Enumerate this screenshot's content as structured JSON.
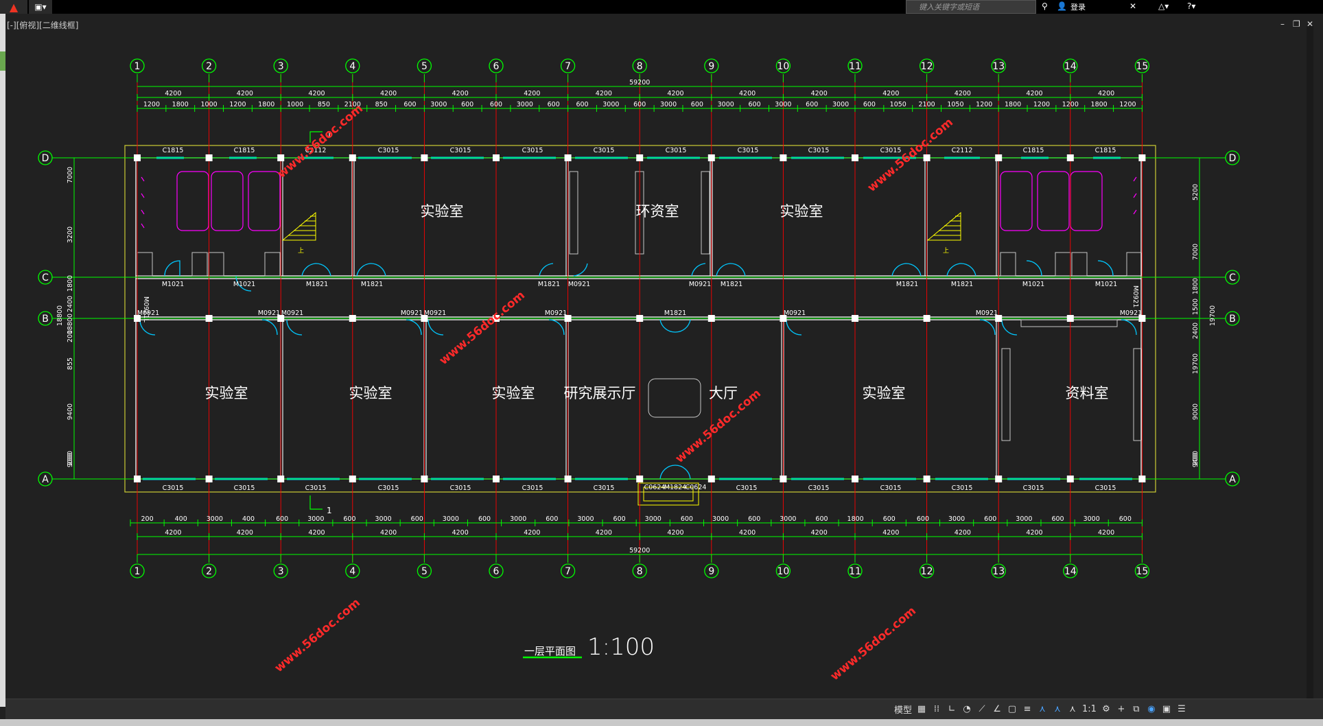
{
  "app": {
    "search_placeholder": "键入关键字或短语",
    "login_label": "登录",
    "view_label": "[-][俯视][二维线框]"
  },
  "drawing": {
    "axes_numbers": [
      "1",
      "2",
      "3",
      "4",
      "5",
      "6",
      "7",
      "8",
      "9",
      "10",
      "11",
      "12",
      "13",
      "14",
      "15"
    ],
    "axes_letters": [
      "D",
      "C",
      "B",
      "A"
    ],
    "total_dimension": "59200",
    "right_total": "19700",
    "left_total": "18800",
    "top_bay_dims": [
      "4200",
      "4200",
      "4200",
      "4200",
      "4200",
      "4200",
      "4200",
      "4200",
      "4200",
      "4200",
      "4200",
      "4200",
      "4200",
      "4200"
    ],
    "bottom_bay_dims": [
      "4200",
      "4200",
      "4200",
      "4200",
      "4200",
      "4200",
      "4200",
      "4200",
      "4200",
      "4200",
      "4200",
      "4200",
      "4200",
      "4200"
    ],
    "top_detail_dims": [
      "1200",
      "1800",
      "1000",
      "1200",
      "1800",
      "1000",
      "850",
      "2100",
      "850",
      "600",
      "3000",
      "600",
      "600",
      "3000",
      "600",
      "600",
      "3000",
      "600",
      "3000",
      "600",
      "3000",
      "600",
      "3000",
      "600",
      "3000",
      "600",
      "1050",
      "2100",
      "1050",
      "1200",
      "1800",
      "1200",
      "1200",
      "1800",
      "1200"
    ],
    "bottom_detail_dims": [
      "200",
      "400",
      "3000",
      "400",
      "600",
      "3000",
      "600",
      "3000",
      "600",
      "3000",
      "600",
      "3000",
      "600",
      "3000",
      "600",
      "3000",
      "600",
      "3000",
      "600",
      "3000",
      "600",
      "1800",
      "600",
      "600",
      "3000",
      "600",
      "3000",
      "600",
      "3000",
      "600"
    ],
    "top_windows": [
      "C1815",
      "C1815",
      "C2112",
      "C3015",
      "C3015",
      "C3015",
      "C3015",
      "C3015",
      "C3015",
      "C3015",
      "C3015",
      "C2112",
      "C1815",
      "C1815"
    ],
    "bottom_windows": [
      "C3015",
      "C3015",
      "C3015",
      "C3015",
      "C3015",
      "C3015",
      "C3015",
      "C3015",
      "C3015",
      "C3015",
      "C3015",
      "C3015",
      "C3015"
    ],
    "bottom_center_labels": [
      "C0624",
      "M1824",
      "C0624"
    ],
    "corridor_doors": [
      "M1021",
      "M1021",
      "M1821",
      "M1821",
      "M1821",
      "M0921",
      "M0921",
      "M1821",
      "M1821",
      "M1821",
      "M1021",
      "M1021"
    ],
    "lower_doors": [
      "M0921",
      "M0921",
      "M0921",
      "M0921",
      "M0921",
      "M0921",
      "M1821",
      "M0921",
      "M0921",
      "M0921"
    ],
    "left_side_door": "M0921L",
    "right_side_door": "M0921",
    "left_dims": [
      "7000",
      "3200",
      "1800",
      "2400",
      "18800",
      "200",
      "855",
      "9400",
      "9000",
      "200"
    ],
    "right_dims": [
      "5200",
      "7000",
      "1800",
      "1500",
      "2400",
      "19700",
      "9000",
      "9400",
      "200"
    ],
    "rooms_top": [
      "实验室",
      "环资室",
      "实验室"
    ],
    "rooms_bottom": [
      "实验室",
      "实验室",
      "实验室",
      "研究展示厅",
      "大厅",
      "实验室",
      "资料室"
    ],
    "section_mark": "1",
    "stair_label": "上",
    "plan_title": "一层平面图",
    "scale": "1:100",
    "watermark": "www.56doc.com"
  },
  "statusbar": {
    "model_label": "模型",
    "annotation_scale": "1:1"
  },
  "colors": {
    "axis_green": "#00ff00",
    "grid_red": "#ff0000",
    "wall_white": "#ffffff",
    "window_cyan": "#00c8ff",
    "outline_yellow": "#ffff00",
    "fixture_magenta": "#ff00ff",
    "watermark_red": "#ff2a2a"
  }
}
